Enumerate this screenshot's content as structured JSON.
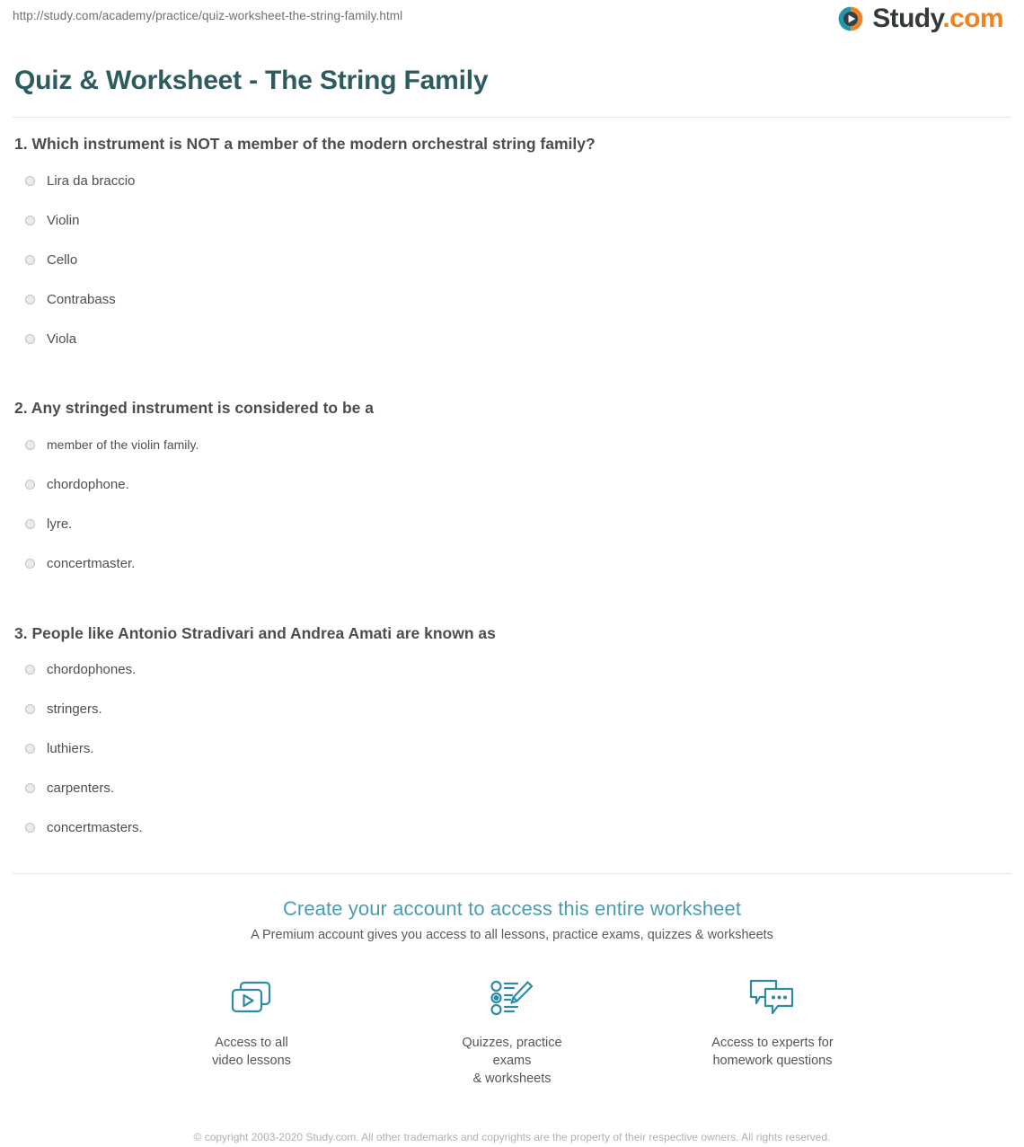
{
  "browser": {
    "url": "http://study.com/academy/practice/quiz-worksheet-the-string-family.html"
  },
  "brand": {
    "name_main": "Study",
    "name_suffix": ".com",
    "logo_icon": "play-circle-icon",
    "colors": {
      "teal": "#2196ad",
      "orange": "#f08222",
      "title_teal": "#2d5b60",
      "cta_teal": "#4c9cb0",
      "icon_teal": "#2d8ca3"
    }
  },
  "page_title": "Quiz & Worksheet - The String Family",
  "questions": [
    {
      "number": "1.",
      "text": "1. Which instrument is NOT a member of the modern orchestral string family?",
      "options": [
        "Lira da braccio",
        "Violin",
        "Cello",
        "Contrabass",
        "Viola"
      ]
    },
    {
      "number": "2.",
      "text": "2. Any stringed instrument is considered to be a",
      "options": [
        "member of the violin family.",
        "chordophone.",
        "lyre.",
        "concertmaster."
      ]
    },
    {
      "number": "3.",
      "text": "3. People like Antonio Stradivari and Andrea Amati are known as",
      "options": [
        "chordophones.",
        "stringers.",
        "luthiers.",
        "carpenters.",
        "concertmasters."
      ]
    }
  ],
  "cta": {
    "title": "Create your account to access this entire worksheet",
    "subtitle": "A Premium account gives you access to all lessons, practice exams, quizzes & worksheets",
    "features": [
      {
        "icon": "video-lessons-icon",
        "label": "Access to all\nvideo lessons"
      },
      {
        "icon": "quiz-pencil-icon",
        "label": "Quizzes, practice exams\n& worksheets"
      },
      {
        "icon": "chat-bubbles-icon",
        "label": "Access to experts for\nhomework questions"
      }
    ]
  },
  "footer": {
    "copyright": "© copyright 2003-2020 Study.com. All other trademarks and copyrights are the property of their respective owners. All rights reserved."
  }
}
